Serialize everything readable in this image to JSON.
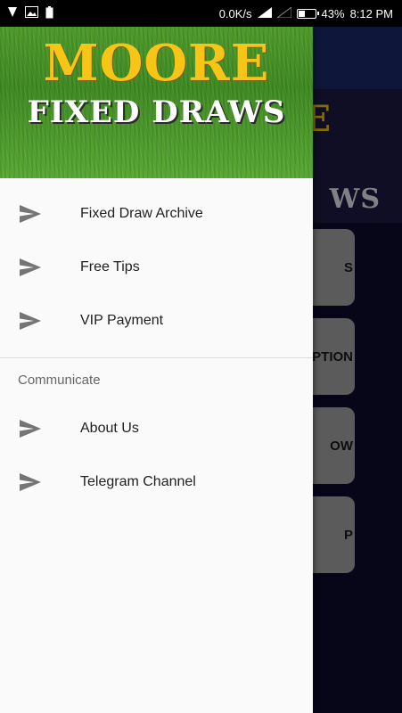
{
  "status_bar": {
    "speed": "0.0K/s",
    "battery": "43%",
    "battery_level": 0.43,
    "time": "8:12 PM"
  },
  "background": {
    "banner_top": "E",
    "banner_bottom": "WS",
    "buttons": [
      "S",
      "PTION",
      "OW",
      "P"
    ]
  },
  "drawer": {
    "header": {
      "title_top": "MOORE",
      "title_bottom": "FIXED DRAWS"
    },
    "main_items": [
      {
        "label": "Fixed Draw Archive",
        "icon": "send-icon"
      },
      {
        "label": "Free Tips",
        "icon": "send-icon"
      },
      {
        "label": "VIP Payment",
        "icon": "send-icon"
      }
    ],
    "section_title": "Communicate",
    "communicate_items": [
      {
        "label": "About Us",
        "icon": "send-icon"
      },
      {
        "label": "Telegram Channel",
        "icon": "send-icon"
      }
    ]
  },
  "colors": {
    "accent_yellow": "#f8c517",
    "grass_green": "#4e9a2a",
    "toolbar_blue": "#1b2a6b",
    "background_navy": "#0d0b2e"
  }
}
